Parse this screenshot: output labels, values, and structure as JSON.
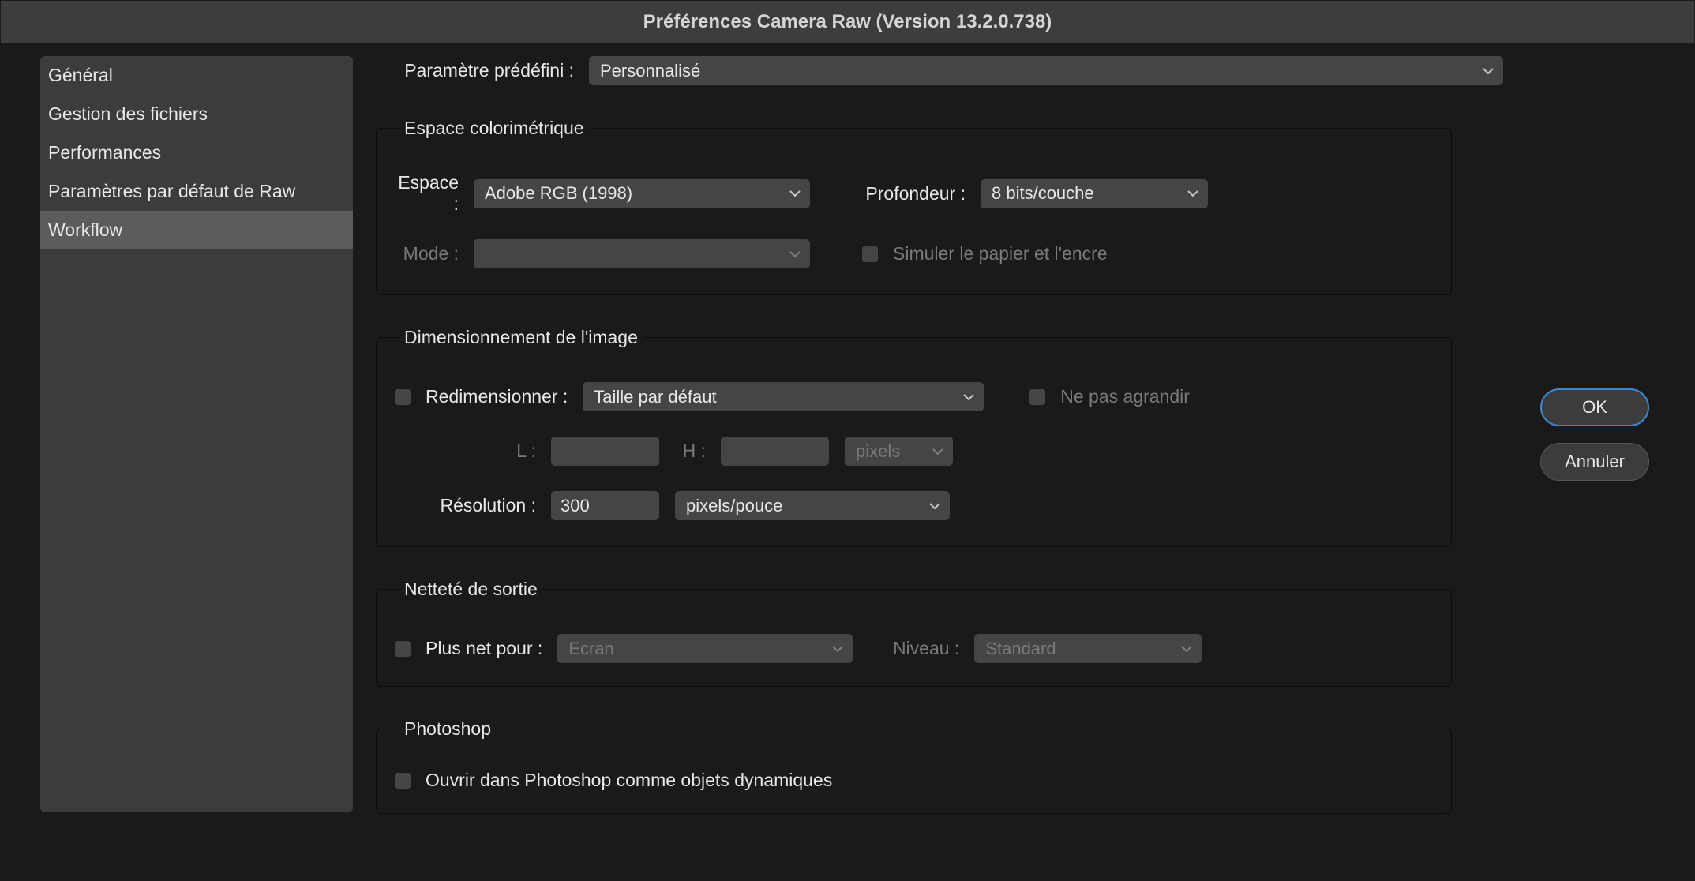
{
  "title": "Préférences Camera Raw  (Version 13.2.0.738)",
  "sidebar": {
    "items": [
      {
        "label": "Général"
      },
      {
        "label": "Gestion des fichiers"
      },
      {
        "label": "Performances"
      },
      {
        "label": "Paramètres par défaut de Raw"
      },
      {
        "label": "Workflow"
      }
    ]
  },
  "buttons": {
    "ok": "OK",
    "cancel": "Annuler"
  },
  "preset": {
    "label": "Paramètre prédéfini :",
    "value": "Personnalisé"
  },
  "groups": {
    "colorspace": {
      "title": "Espace colorimétrique",
      "space_label": "Espace :",
      "space_value": "Adobe RGB (1998)",
      "depth_label": "Profondeur :",
      "depth_value": "8 bits/couche",
      "mode_label": "Mode :",
      "mode_value": "",
      "simulate_label": "Simuler le papier et l'encre"
    },
    "sizing": {
      "title": "Dimensionnement de l'image",
      "resize_label": "Redimensionner :",
      "resize_value": "Taille par défaut",
      "no_enlarge_label": "Ne pas agrandir",
      "w_label": "L :",
      "h_label": "H :",
      "units_value": "pixels",
      "resolution_label": "Résolution :",
      "resolution_value": "300",
      "resolution_units_value": "pixels/pouce"
    },
    "sharpen": {
      "title": "Netteté de sortie",
      "sharpen_for_label": "Plus net pour :",
      "sharpen_for_value": "Ecran",
      "amount_label": "Niveau :",
      "amount_value": "Standard"
    },
    "photoshop": {
      "title": "Photoshop",
      "smart_objects_label": "Ouvrir dans Photoshop comme objets dynamiques"
    }
  }
}
